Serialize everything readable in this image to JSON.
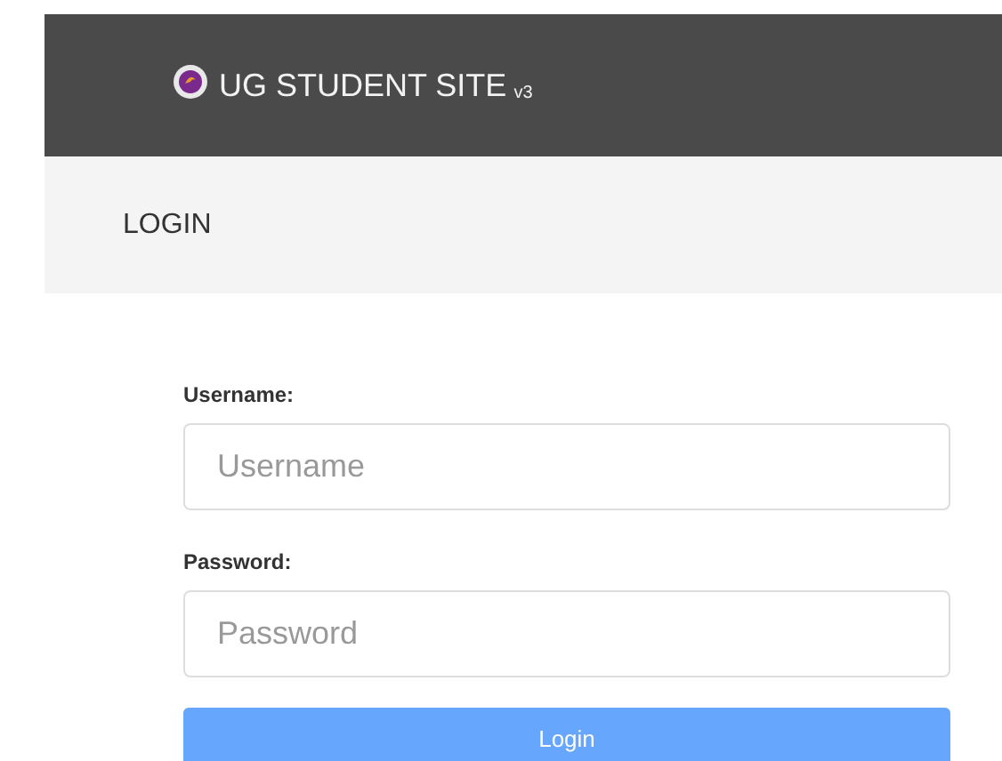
{
  "header": {
    "title": "UG STUDENT SITE",
    "version": "v3"
  },
  "page_title": "LOGIN",
  "form": {
    "fields": [
      {
        "label": "Username:",
        "placeholder": "Username"
      },
      {
        "label": "Password:",
        "placeholder": "Password"
      }
    ],
    "submit": "Login"
  }
}
